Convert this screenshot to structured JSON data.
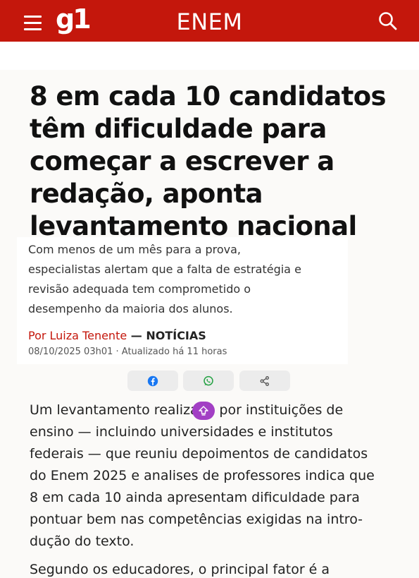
{
  "header": {
    "logo": "g1",
    "section": "ENEM",
    "menu_icon": "hamburger-menu-icon",
    "search_icon": "search-icon",
    "brand_color": "#c4170c"
  },
  "article": {
    "headline": "8 em cada 10 candidatos têm dificuldade para começar a escrever a redação, aponta levantamento nacional",
    "headline_lines": [
      "8 em cada 10 candidatos",
      "têm dificuldade para",
      "começar a escrever a",
      "redação, aponta",
      "levantamento nacional"
    ],
    "summary_lines": [
      "Com menos de um mês para a prova,",
      "especialistas alertam que a falta de estratégia e",
      "revisão adequada tem comprometido o",
      "desempenho da maioria dos alunos."
    ],
    "author": "Por Luiza Tenente",
    "separator": " — ",
    "section_tag": "NOTÍCIAS",
    "dateline": "08/10/2025 03h01 · Atualizado há 11 horas",
    "share": {
      "facebook_icon": "facebook-icon",
      "whatsapp_icon": "whatsapp-icon",
      "share_icon": "share-icon"
    },
    "p1_lines": [
      "Um levantamento realizado por instituições de",
      "ensino — incluindo universidades e institutos",
      "federais — que reuniu depoimentos de candidatos",
      "do Enem 2025 e analises de professores indica que",
      "8 em cada 10 ainda apresentam dificuldade para",
      "pontuar bem nas competências exigidas na intro-",
      "dução do texto."
    ],
    "p2_lines": [
      "Segundo os educadores, o principal fator é a"
    ],
    "float_icon": "scroll-top-icon",
    "float_color": "#a23fc4"
  }
}
